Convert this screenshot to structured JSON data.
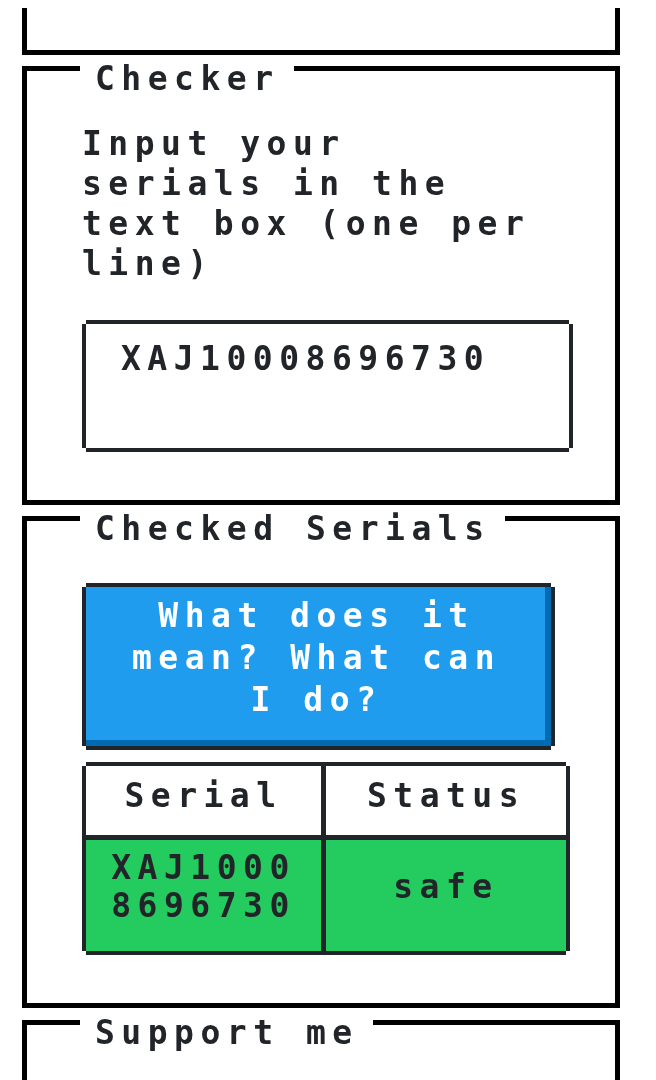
{
  "panels": [
    {
      "kind": "cut_off"
    },
    {
      "kind": "checker",
      "title": "Checker",
      "instructions": "Input your serials in the text box (one per line)",
      "serials_field": {
        "value": "XAJ10008696730"
      }
    },
    {
      "kind": "results",
      "title": "Checked Serials",
      "help_button": "What does it mean? What can I do?",
      "table": {
        "columns": [
          "Serial",
          "Status"
        ],
        "rows": [
          {
            "color": "#24cc5f",
            "cells": [
              "XAJ10008696730",
              "safe"
            ]
          }
        ]
      }
    },
    {
      "kind": "support",
      "title": "Support me"
    }
  ]
}
